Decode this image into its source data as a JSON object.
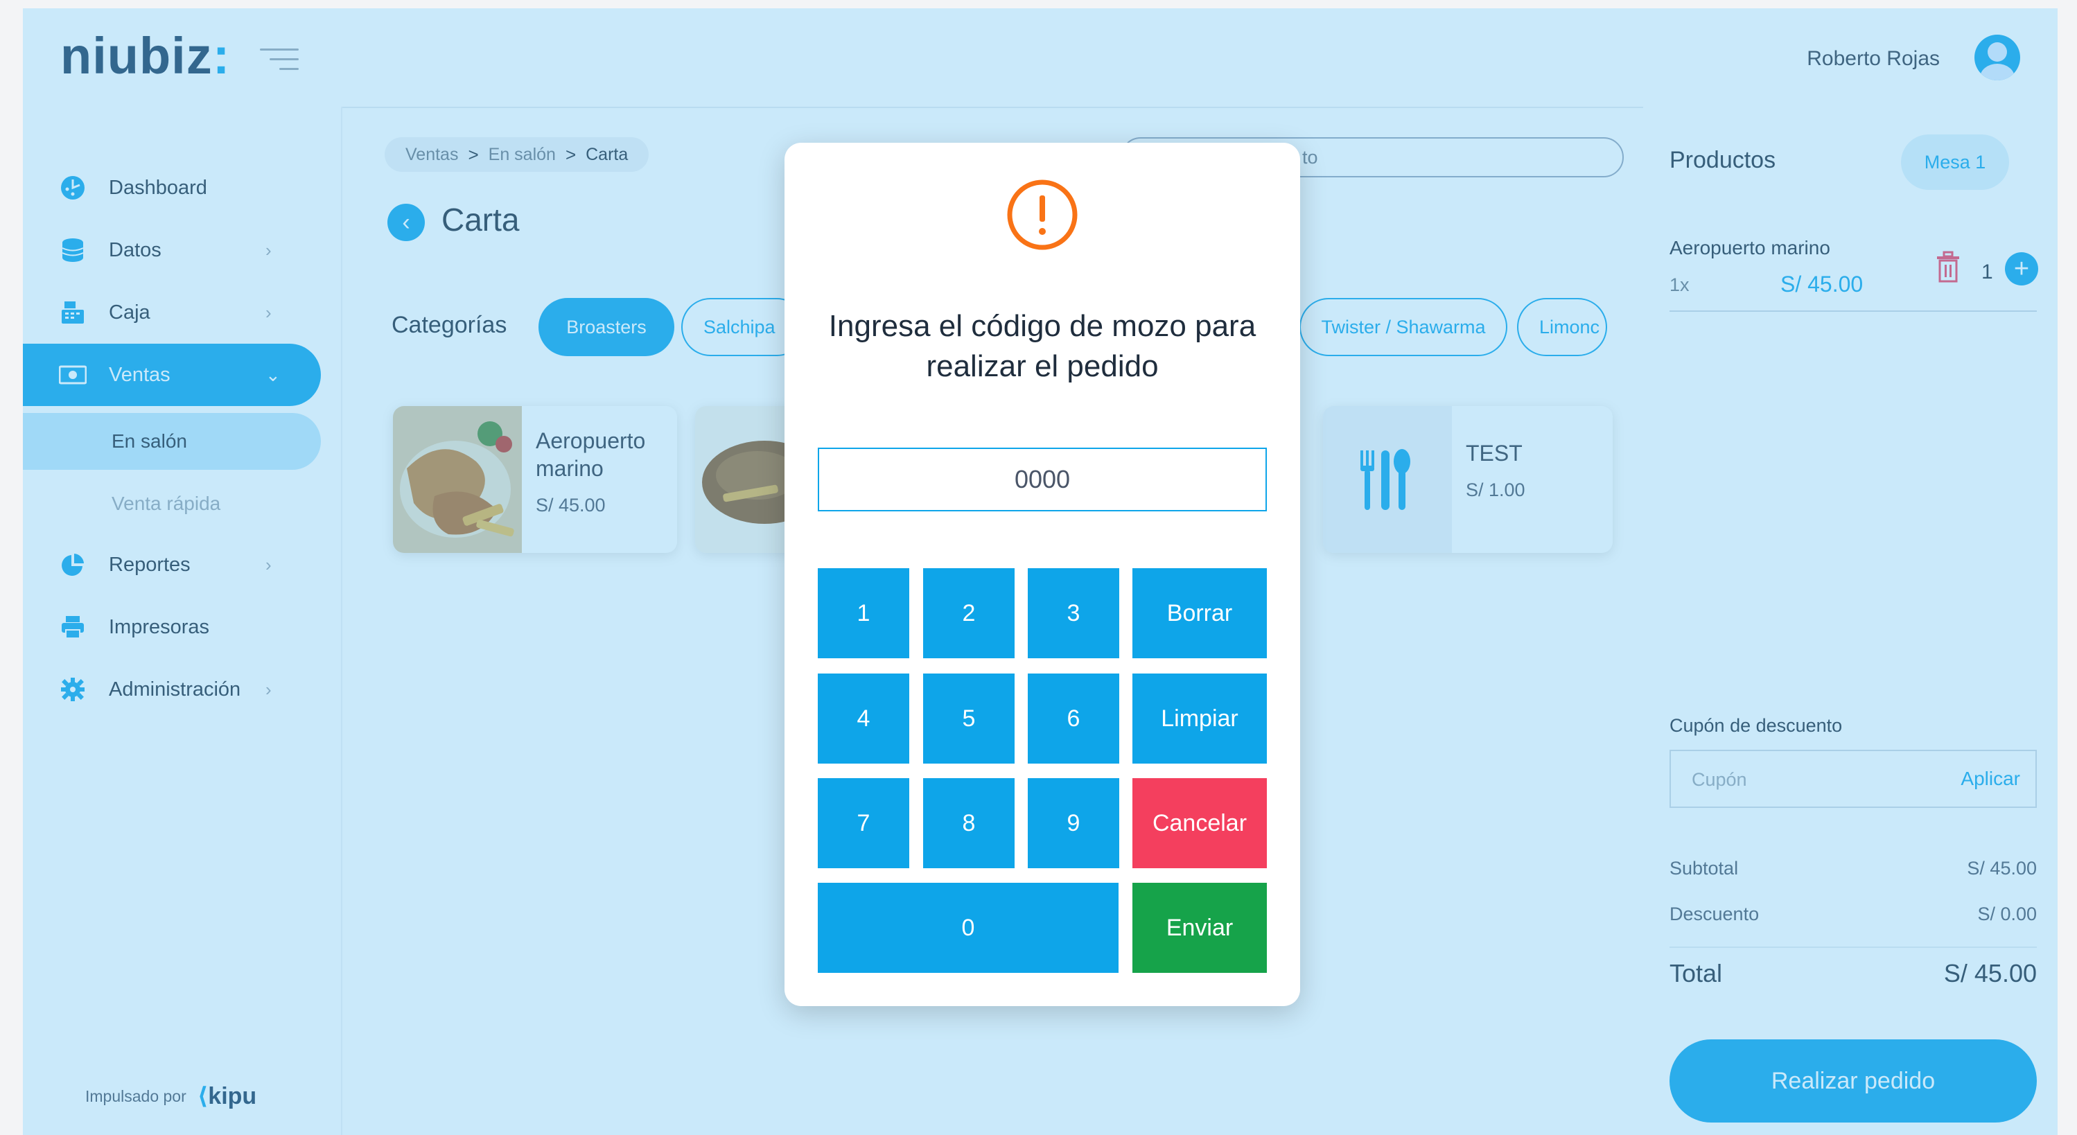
{
  "colors": {
    "accent": "#0ea5e9",
    "danger": "#f43f5e",
    "success": "#16a34a",
    "warning": "#f97316"
  },
  "header": {
    "logo": "niubiz",
    "user_name": "Roberto Rojas"
  },
  "sidebar": {
    "items": [
      {
        "label": "Dashboard",
        "icon": "dashboard-icon"
      },
      {
        "label": "Datos",
        "icon": "database-icon"
      },
      {
        "label": "Caja",
        "icon": "cash-register-icon"
      },
      {
        "label": "Ventas",
        "icon": "money-icon"
      },
      {
        "label": "Reportes",
        "icon": "pie-chart-icon"
      },
      {
        "label": "Impresoras",
        "icon": "printer-icon"
      },
      {
        "label": "Administración",
        "icon": "gear-icon"
      }
    ],
    "sub_items": [
      {
        "label": "En salón"
      },
      {
        "label": "Venta rápida"
      }
    ],
    "powered_by": "Impulsado por",
    "brand": "kipu"
  },
  "main": {
    "breadcrumb": [
      "Ventas",
      "En salón",
      "Carta"
    ],
    "title": "Carta",
    "search_placeholder": "to",
    "categories_label": "Categorías",
    "categories": [
      "Broasters",
      "Salchipa",
      "Twister / Shawarma",
      "Limonc"
    ],
    "products": [
      {
        "name": "Aeropuerto marino",
        "price": "S/ 45.00"
      },
      {
        "name": "TEST",
        "price": "S/ 1.00"
      }
    ]
  },
  "cart": {
    "title": "Productos",
    "table": "Mesa 1",
    "items": [
      {
        "name": "Aeropuerto marino",
        "qty_label": "1x",
        "price": "S/ 45.00",
        "qty": "1"
      }
    ],
    "coupon_label": "Cupón de descuento",
    "coupon_placeholder": "Cupón",
    "apply": "Aplicar",
    "subtotal_label": "Subtotal",
    "subtotal": "S/ 45.00",
    "discount_label": "Descuento",
    "discount": "S/ 0.00",
    "total_label": "Total",
    "total": "S/ 45.00",
    "order_button": "Realizar pedido"
  },
  "modal": {
    "title": "Ingresa el código de mozo para realizar el pedido",
    "code_value": "0000",
    "keys": [
      "1",
      "2",
      "3",
      "4",
      "5",
      "6",
      "7",
      "8",
      "9",
      "0"
    ],
    "delete": "Borrar",
    "clear": "Limpiar",
    "cancel": "Cancelar",
    "send": "Enviar"
  }
}
